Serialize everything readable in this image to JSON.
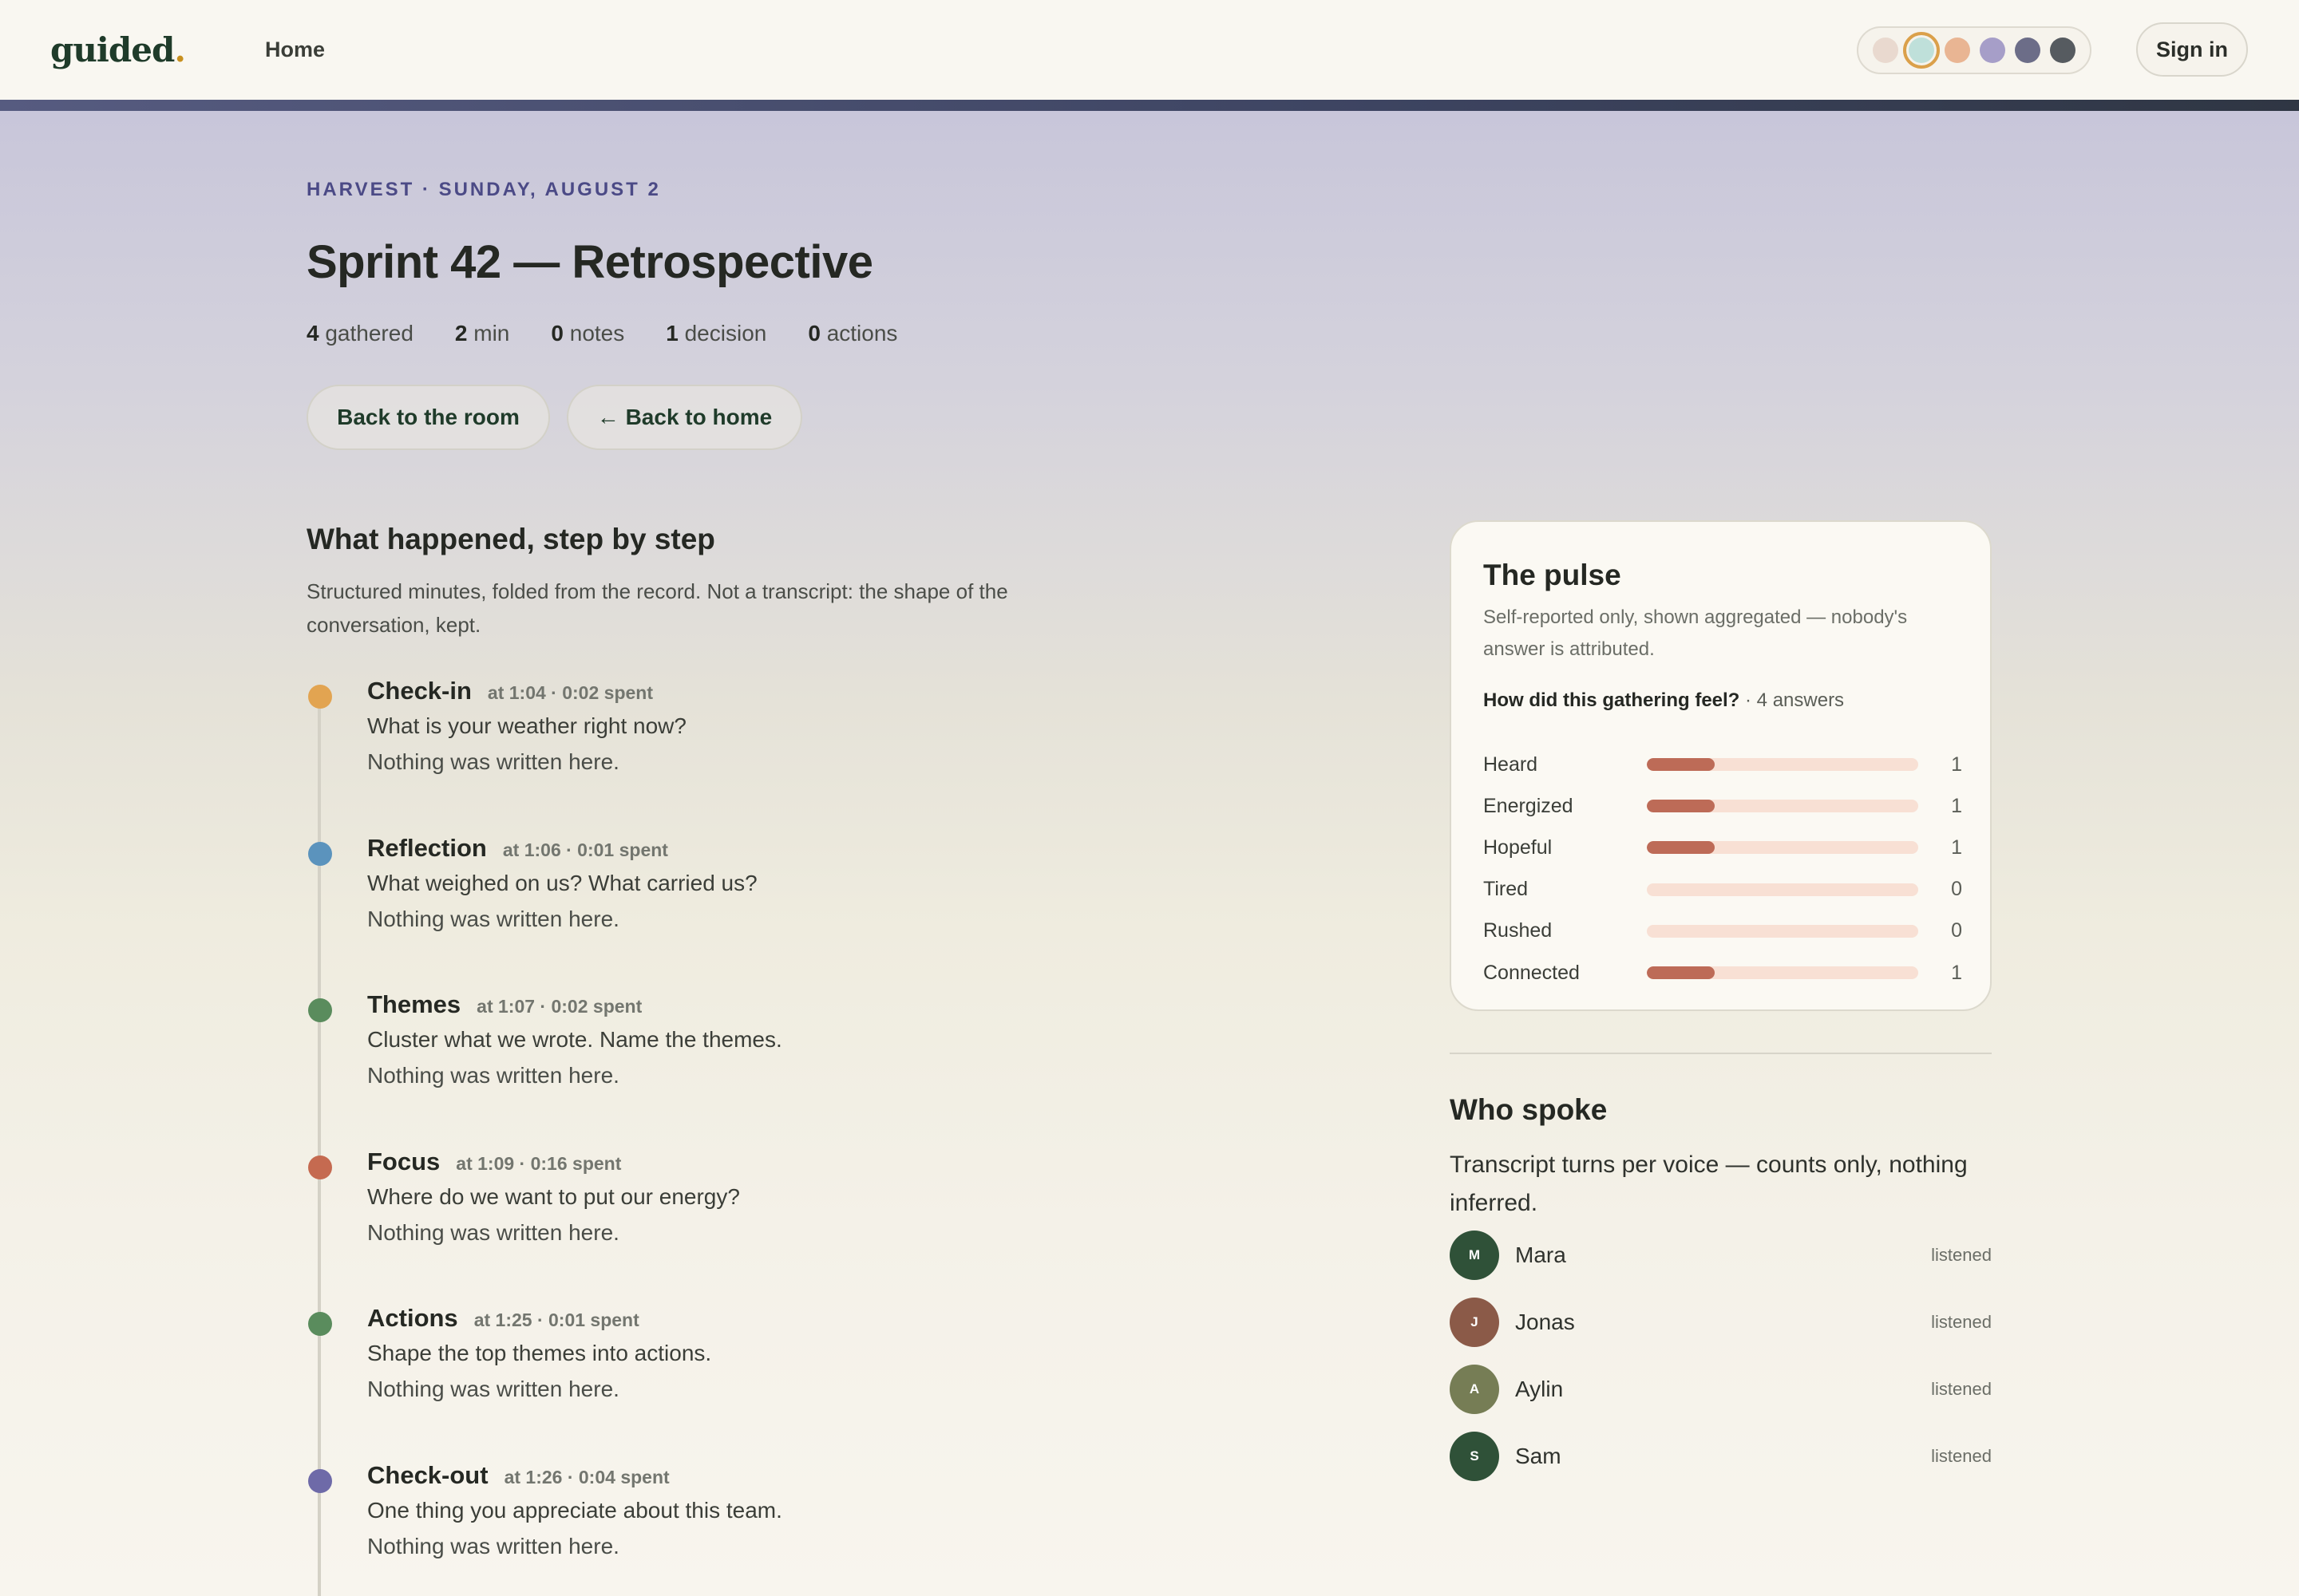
{
  "header": {
    "logo": "guided",
    "logo_dot": ".",
    "nav_home": "Home",
    "sign_in": "Sign in",
    "theme_swatches": [
      {
        "color": "#e9d9cf",
        "selected": false
      },
      {
        "color": "#bfe0da",
        "selected": true
      },
      {
        "color": "#e9b593",
        "selected": false
      },
      {
        "color": "#a69ec8",
        "selected": false
      },
      {
        "color": "#6c6d88",
        "selected": false
      },
      {
        "color": "#565b60",
        "selected": false
      }
    ]
  },
  "page": {
    "eyebrow": "HARVEST · SUNDAY, AUGUST 2",
    "title": "Sprint 42 — Retrospective",
    "stats": [
      {
        "value": "4",
        "label": "gathered"
      },
      {
        "value": "2",
        "label": "min"
      },
      {
        "value": "0",
        "label": "notes"
      },
      {
        "value": "1",
        "label": "decision"
      },
      {
        "value": "0",
        "label": "actions"
      }
    ],
    "back_room": "Back to the room",
    "back_home": "← Back to home"
  },
  "steps": {
    "title": "What happened, step by step",
    "description": "Structured minutes, folded from the record. Not a transcript: the shape of the conversation, kept.",
    "items": [
      {
        "name": "Check-in",
        "meta": "at 1:04 · 0:02 spent",
        "prompt": "What is your weather right now?",
        "note": "Nothing was written here.",
        "color": "#e2a451"
      },
      {
        "name": "Reflection",
        "meta": "at 1:06 · 0:01 spent",
        "prompt": "What weighed on us? What carried us?",
        "note": "Nothing was written here.",
        "color": "#5b93bd"
      },
      {
        "name": "Themes",
        "meta": "at 1:07 · 0:02 spent",
        "prompt": "Cluster what we wrote. Name the themes.",
        "note": "Nothing was written here.",
        "color": "#5a8c5d"
      },
      {
        "name": "Focus",
        "meta": "at 1:09 · 0:16 spent",
        "prompt": "Where do we want to put our energy?",
        "note": "Nothing was written here.",
        "color": "#c56a50"
      },
      {
        "name": "Actions",
        "meta": "at 1:25 · 0:01 spent",
        "prompt": "Shape the top themes into actions.",
        "note": "Nothing was written here.",
        "color": "#5a8c5d"
      },
      {
        "name": "Check-out",
        "meta": "at 1:26 · 0:04 spent",
        "prompt": "One thing you appreciate about this team.",
        "note": "Nothing was written here.",
        "color": "#6e6aa8"
      }
    ]
  },
  "pulse": {
    "title": "The pulse",
    "subtitle": "Self-reported only, shown aggregated — nobody's answer is attributed.",
    "question": "How did this gathering feel?",
    "answers_text": " · 4 answers",
    "total": 4,
    "rows": [
      {
        "label": "Heard",
        "count": 1
      },
      {
        "label": "Energized",
        "count": 1
      },
      {
        "label": "Hopeful",
        "count": 1
      },
      {
        "label": "Tired",
        "count": 0
      },
      {
        "label": "Rushed",
        "count": 0
      },
      {
        "label": "Connected",
        "count": 1
      }
    ]
  },
  "who": {
    "title": "Who spoke",
    "description": "Transcript turns per voice — counts only, nothing inferred.",
    "speakers": [
      {
        "initial": "M",
        "name": "Mara",
        "status": "listened",
        "color": "#2f5138"
      },
      {
        "initial": "J",
        "name": "Jonas",
        "status": "listened",
        "color": "#8b5a48"
      },
      {
        "initial": "A",
        "name": "Aylin",
        "status": "listened",
        "color": "#767d55"
      },
      {
        "initial": "S",
        "name": "Sam",
        "status": "listened",
        "color": "#2f5138"
      }
    ]
  }
}
